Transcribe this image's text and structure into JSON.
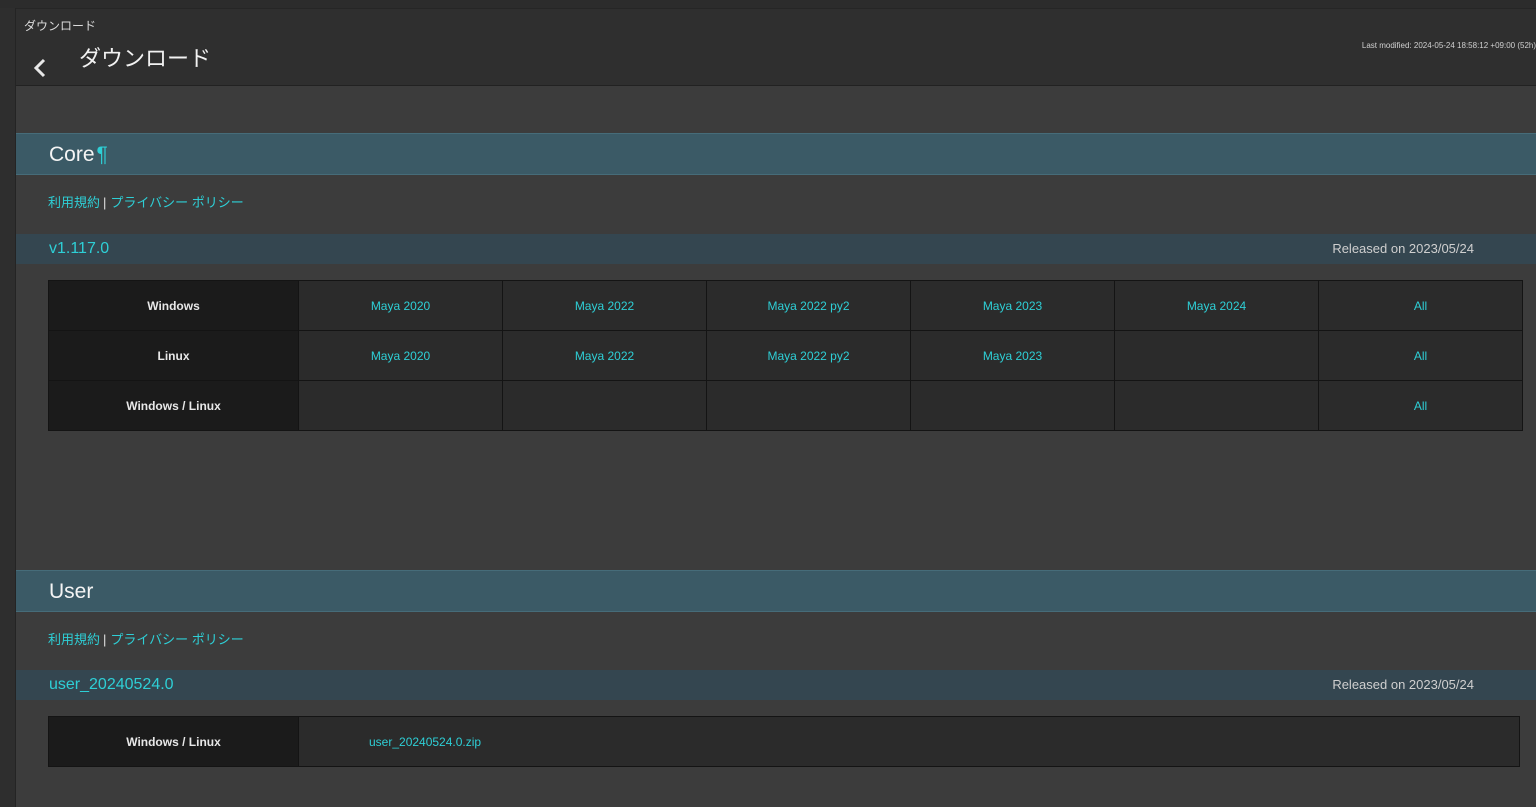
{
  "header": {
    "breadcrumb": "ダウンロード",
    "title": "ダウンロード",
    "last_modified": "Last modified: 2024-05-24 18:58:12 +09:00 (52h)"
  },
  "core": {
    "title": "Core",
    "anchor": "¶",
    "terms_link": "利用規約",
    "separator": "|",
    "privacy_link": "プライバシー ポリシー",
    "version": "v1.117.0",
    "released": "Released on 2023/05/24",
    "rows": [
      {
        "platform": "Windows",
        "cells": [
          "Maya 2020",
          "Maya 2022",
          "Maya 2022 py2",
          "Maya 2023",
          "Maya 2024",
          "All"
        ]
      },
      {
        "platform": "Linux",
        "cells": [
          "Maya 2020",
          "Maya 2022",
          "Maya 2022 py2",
          "Maya 2023",
          "",
          "All"
        ]
      },
      {
        "platform": "Windows / Linux",
        "cells": [
          "",
          "",
          "",
          "",
          "",
          "All"
        ]
      }
    ]
  },
  "user": {
    "title": "User",
    "terms_link": "利用規約",
    "separator": "|",
    "privacy_link": "プライバシー ポリシー",
    "version": "user_20240524.0",
    "released": "Released on 2023/05/24",
    "platform": "Windows / Linux",
    "file": "user_20240524.0.zip"
  },
  "colors": {
    "accent": "#2ecfd6",
    "section_header": "#3b5a66",
    "version_bar": "#344650"
  }
}
